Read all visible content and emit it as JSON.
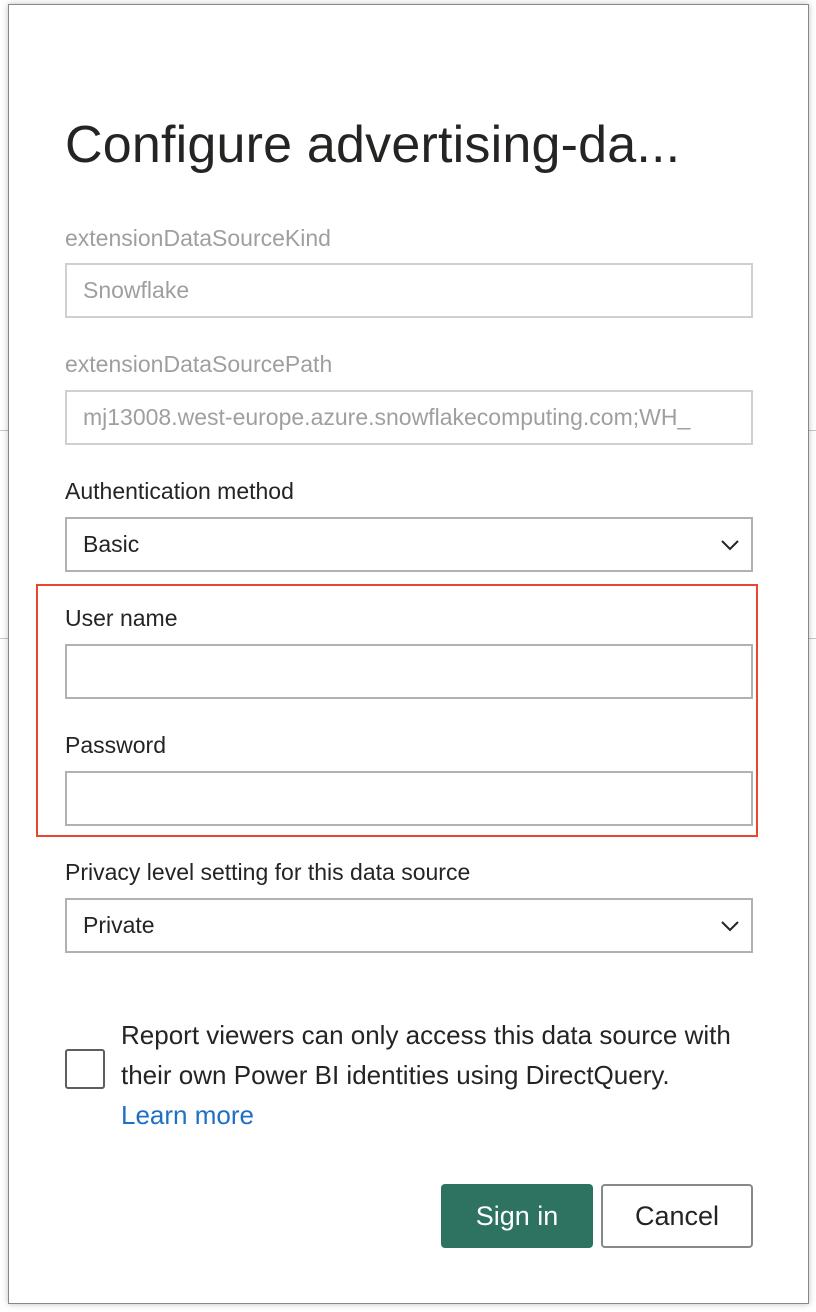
{
  "dialog": {
    "title": "Configure advertising-da...",
    "fields": {
      "kind_label": "extensionDataSourceKind",
      "kind_value": "Snowflake",
      "path_label": "extensionDataSourcePath",
      "path_value": "mj13008.west-europe.azure.snowflakecomputing.com;WH_",
      "auth_label": "Authentication method",
      "auth_value": "Basic",
      "username_label": "User name",
      "username_value": "",
      "password_label": "Password",
      "password_value": "",
      "privacy_label": "Privacy level setting for this data source",
      "privacy_value": "Private"
    },
    "checkbox": {
      "checked": false,
      "text": "Report viewers can only access this data source with their own Power BI identities using DirectQuery.",
      "link": "Learn more"
    },
    "buttons": {
      "signin": "Sign in",
      "cancel": "Cancel"
    }
  },
  "colors": {
    "primary": "#2e7361",
    "highlight": "#e8472e",
    "link": "#1f6fc5"
  },
  "icons": [
    "chevron-down-icon"
  ]
}
